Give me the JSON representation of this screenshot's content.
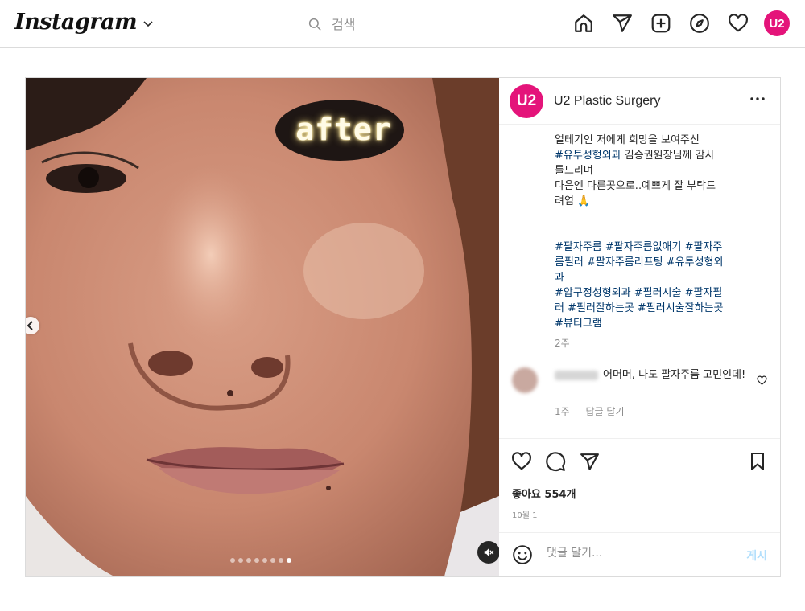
{
  "nav": {
    "logo": "Instagram",
    "search_placeholder": "검색",
    "avatar_text": "U2",
    "icons": [
      "home-icon",
      "send-icon",
      "new-post-icon",
      "explore-icon",
      "heart-icon"
    ]
  },
  "post": {
    "overlay_text": "after",
    "carousel": {
      "total": 8,
      "active_index": 7
    },
    "author": {
      "name": "U2 Plastic Surgery",
      "avatar_text": "U2"
    },
    "caption": {
      "text_lines": [
        "얼테기인 저에게 희망을 보여주신",
        "#유투성형외과 김승권원장님께 감사",
        "를드리며",
        "다음엔 다른곳으로..예쁘게 잘 부탁드",
        "려염 🙏"
      ],
      "hashtag_lines": [
        "#팔자주름 #팔자주름없애기 #팔자주",
        "름필러 #팔자주름리프팅 #유투성형외",
        "과",
        "#압구정성형외과 #필러시술 #팔자필",
        "러 #필러잘하는곳 #필러시술잘하는곳",
        "#뷰티그램"
      ],
      "time": "2주"
    },
    "comment": {
      "text": "어머머, 나도 팔자주름 고민인데!",
      "time": "1주",
      "reply_label": "답글 달기"
    },
    "likes": "좋아요 554개",
    "date": "10월 1",
    "comment_placeholder": "댓글 달기...",
    "post_button": "게시"
  },
  "colors": {
    "brand_pink": "#e4147a",
    "hashtag": "#00376b",
    "muted": "#8e8e8e",
    "border": "#dbdbdb"
  }
}
